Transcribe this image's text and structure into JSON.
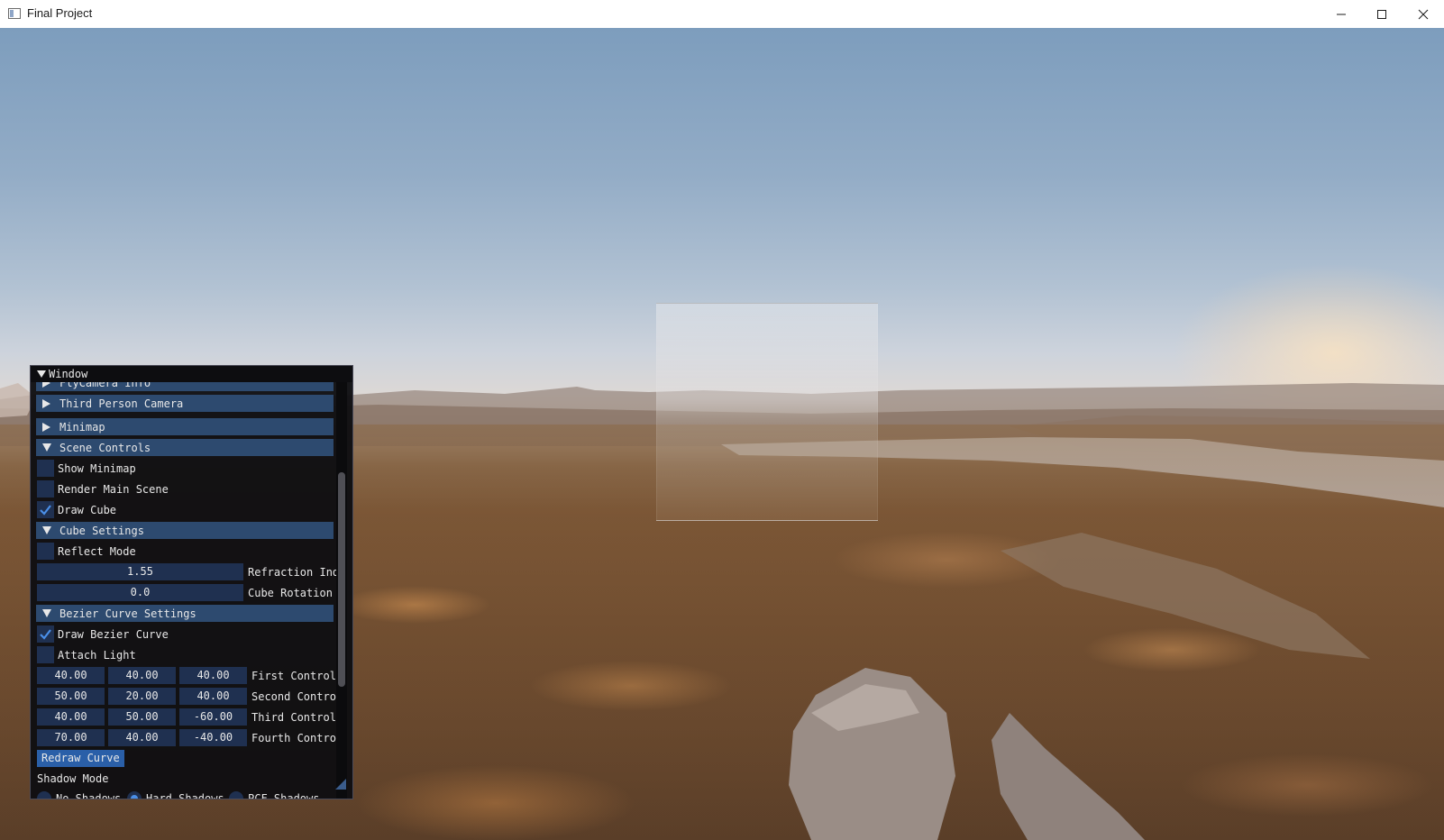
{
  "window": {
    "title": "Final Project"
  },
  "panel": {
    "title": "Window",
    "headers": {
      "fly_camera": "FlyCamera Info",
      "third_person": "Third Person Camera",
      "minimap": "Minimap",
      "scene_controls": "Scene Controls",
      "cube_settings": "Cube Settings",
      "bezier": "Bezier Curve Settings"
    },
    "scene_controls": {
      "show_minimap": {
        "label": "Show Minimap",
        "checked": false
      },
      "render_main_scene": {
        "label": "Render Main Scene",
        "checked": false
      },
      "draw_cube": {
        "label": "Draw Cube",
        "checked": true
      }
    },
    "cube_settings": {
      "reflect_mode": {
        "label": "Reflect Mode",
        "checked": false
      },
      "refraction": {
        "value": "1.55",
        "label": "Refraction Ind"
      },
      "rotation": {
        "value": "0.0",
        "label": "Cube Rotation"
      }
    },
    "bezier": {
      "draw_curve": {
        "label": "Draw Bezier Curve",
        "checked": true
      },
      "attach_light": {
        "label": "Attach Light",
        "checked": false
      },
      "controls": [
        {
          "label": "First Control",
          "x": "40.00",
          "y": "40.00",
          "z": "40.00"
        },
        {
          "label": "Second Control",
          "x": "50.00",
          "y": "20.00",
          "z": "40.00"
        },
        {
          "label": "Third Control",
          "x": "40.00",
          "y": "50.00",
          "z": "-60.00"
        },
        {
          "label": "Fourth Control",
          "x": "70.00",
          "y": "40.00",
          "z": "-40.00"
        }
      ],
      "redraw_button": "Redraw Curve"
    },
    "shadow": {
      "label": "Shadow Mode",
      "options": [
        "No Shadows",
        "Hard Shadows",
        "PCF Shadows"
      ],
      "selected": "Hard Shadows"
    }
  },
  "colors": {
    "header_bg": "#2d4a6f",
    "frame_bg": "#1f3050",
    "checkmark": "#4a8fe8",
    "button_bg": "#2a5fa8"
  }
}
